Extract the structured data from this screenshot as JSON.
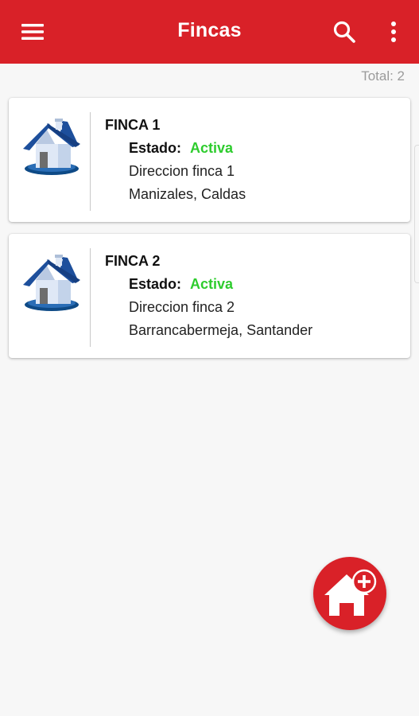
{
  "appbar": {
    "title": "Fincas",
    "icons": [
      "menu-icon",
      "search-icon",
      "more-vert-icon"
    ],
    "color": "#d92128"
  },
  "total": "Total:  2",
  "fincas": [
    {
      "name": "FINCA 1",
      "state_label": "Estado:",
      "state_value": "Activa",
      "address": "Direccion finca 1",
      "city": "Manizales, Caldas"
    },
    {
      "name": "FINCA 2",
      "state_label": "Estado:",
      "state_value": "Activa",
      "address": "Direccion finca 2",
      "city": "Barrancabermeja, Santander"
    }
  ],
  "fab": {
    "icon": "add-home-icon"
  },
  "colors": {
    "active": "#2ecc2e",
    "accent": "#d92128"
  }
}
